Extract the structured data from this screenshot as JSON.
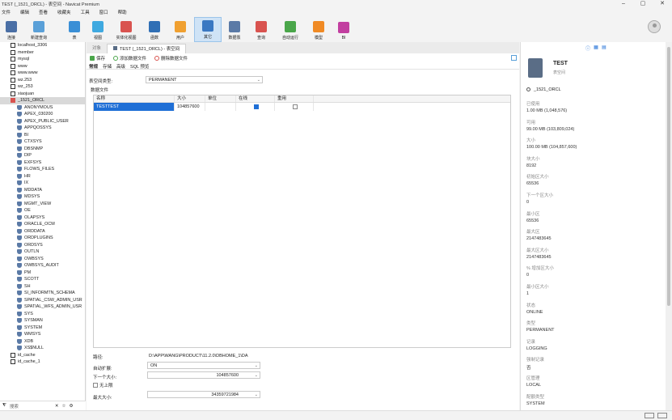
{
  "window": {
    "title": "TEST (_1521_ORCL) - 表空间 - Navicat Premium",
    "min": "–",
    "max": "▢",
    "close": "✕"
  },
  "menu": [
    "文件",
    "编辑",
    "查看",
    "收藏夹",
    "工具",
    "窗口",
    "帮助"
  ],
  "toolbar": [
    {
      "label": "连接",
      "color": "#4a6fa5"
    },
    {
      "label": "新建查询",
      "color": "#5aa0d8"
    },
    {
      "label": "表",
      "color": "#3a8fd6"
    },
    {
      "label": "视图",
      "color": "#3fa9e0"
    },
    {
      "label": "实体化视图",
      "color": "#d9534f"
    },
    {
      "label": "函数",
      "color": "#2f6fb5"
    },
    {
      "label": "用户",
      "color": "#f0a030"
    },
    {
      "label": "其它",
      "color": "#3a78c2"
    },
    {
      "label": "数据泵",
      "color": "#5b7aa6"
    },
    {
      "label": "查询",
      "color": "#d9534f"
    },
    {
      "label": "自动运行",
      "color": "#4aa64a"
    },
    {
      "label": "模型",
      "color": "#f08a24"
    },
    {
      "label": "BI",
      "color": "#c23fa0"
    }
  ],
  "tree": {
    "connections": [
      "localhost_3306",
      "member",
      "mysql",
      "www",
      "www.www",
      "wz.253",
      "wz_253",
      "xiaojuan"
    ],
    "selected": "_1521_ORCL",
    "users": [
      "ANONYMOUS",
      "APEX_030200",
      "APEX_PUBLIC_USER",
      "APPQOSSYS",
      "BI",
      "CTXSYS",
      "DBSNMP",
      "DIP",
      "EXFSYS",
      "FLOWS_FILES",
      "HR",
      "IX",
      "MDDATA",
      "MDSYS",
      "MGMT_VIEW",
      "OE",
      "OLAPSYS",
      "ORACLE_OCM",
      "ORDDATA",
      "ORDPLUGINS",
      "ORDSYS",
      "OUTLN",
      "OWBSYS",
      "OWBSYS_AUDIT",
      "PM",
      "SCOTT",
      "SH",
      "SI_INFORMTN_SCHEMA",
      "SPATIAL_CSW_ADMIN_USR",
      "SPATIAL_WFS_ADMIN_USR",
      "SYS",
      "SYSMAN",
      "SYSTEM",
      "WMSYS",
      "XDB",
      "XS$NULL"
    ],
    "after": [
      "id_cache",
      "id_cache_1"
    ],
    "search_placeholder": "搜索"
  },
  "tabs": {
    "objects": "对象",
    "active": "TEST (_1521_ORCL) - 表空间"
  },
  "editor": {
    "save": "保存",
    "add_file": "添加数据文件",
    "delete_file": "删除数据文件",
    "subtabs": [
      "常规",
      "存储",
      "高级",
      "SQL 预览"
    ],
    "tbs_type_label": "表空间类型:",
    "tbs_type_value": "PERMANENT",
    "datafile_label": "数据文件",
    "grid_headers": [
      "名称",
      "大小",
      "单位",
      "在线",
      "重用"
    ],
    "grid_row": {
      "name": "TESTTEST",
      "size": "104857600",
      "unit": ""
    },
    "path_label": "路径:",
    "path_value": "D:\\APP\\WANG\\PRODUCT\\11.2.0\\DBHOME_1\\DA",
    "autoextend_label": "自动扩展:",
    "autoextend_value": "ON",
    "next_label": "下一个大小:",
    "next_value": "104857600",
    "unlimited_label": "无上限",
    "max_label": "最大大小:",
    "max_value": "34359721984"
  },
  "panel": {
    "name": "TEST",
    "type": "表空间",
    "connection": "_1521_ORCL",
    "props": [
      {
        "k": "已使用",
        "v": "1.00 MB (1,048,576)"
      },
      {
        "k": "可用",
        "v": "99.00 MB (103,809,024)"
      },
      {
        "k": "大小",
        "v": "100.00 MB (104,857,600)"
      },
      {
        "k": "块大小",
        "v": "8192"
      },
      {
        "k": "初始区大小",
        "v": "65536"
      },
      {
        "k": "下一个区大小",
        "v": "0"
      },
      {
        "k": "最小区",
        "v": "65536"
      },
      {
        "k": "最大区",
        "v": "2147483645"
      },
      {
        "k": "最大区大小",
        "v": "2147483645"
      },
      {
        "k": "% 增加区大小",
        "v": "0"
      },
      {
        "k": "最小区大小",
        "v": "1"
      },
      {
        "k": "状态",
        "v": "ONLINE"
      },
      {
        "k": "类型",
        "v": "PERMANENT"
      },
      {
        "k": "记录",
        "v": "LOGGING"
      },
      {
        "k": "强制记录",
        "v": "否"
      },
      {
        "k": "区管理",
        "v": "LOCAL"
      },
      {
        "k": "配额类型",
        "v": "SYSTEM"
      }
    ]
  }
}
